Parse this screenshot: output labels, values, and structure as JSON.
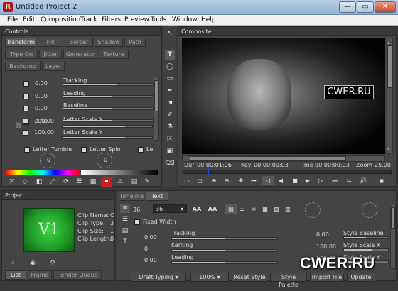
{
  "window": {
    "title": "Untitled Project 2",
    "app_icon_letter": "R",
    "minimize": "—",
    "maximize": "▭",
    "close": "✕"
  },
  "menu": [
    "File",
    "Edit",
    "Composition",
    "Track",
    "Filters",
    "Preview",
    "Tools",
    "Window",
    "Help"
  ],
  "controls": {
    "title": "Controls",
    "tabs_row1": [
      "Transform",
      "Fill",
      "Border",
      "Shadow",
      "Path"
    ],
    "tabs_row2": [
      "Type On",
      "Jitter",
      "Generator",
      "Texture"
    ],
    "tabs_row3": [
      "Backdrop",
      "Layer"
    ],
    "rows": [
      {
        "value": "0.00",
        "label": ""
      },
      {
        "value": "0.00",
        "label": "Tracking"
      },
      {
        "value": "0.00",
        "label": "Leading"
      },
      {
        "value": "0.00",
        "label": "Baseline"
      },
      {
        "value": "100.00",
        "label": "Letter Scale X"
      },
      {
        "value": "100.00",
        "label": "Letter Scale Y"
      }
    ],
    "checks": [
      "Letter Tumble",
      "Letter Spin",
      "Le"
    ],
    "knob_values": [
      "0",
      "0"
    ]
  },
  "composite": {
    "title": "Composite",
    "overlay_text": "CWER.RU",
    "dur_label": "Dur",
    "dur_value": "00:00:01:06",
    "key_label": "Key",
    "key_value": "00:00:00:03",
    "time_label": "Time",
    "time_value": "00:00:00:03",
    "zoom_label": "Zoom",
    "zoom_value": "25.00"
  },
  "project": {
    "title": "Project",
    "thumb_text": "V1",
    "fields": [
      {
        "label": "Clip Name:",
        "value": "C"
      },
      {
        "label": "Clip Type:",
        "value": "3"
      },
      {
        "label": "Clip Size:",
        "value": "1"
      },
      {
        "label": "Clip Length:",
        "value": "0"
      }
    ],
    "tabs": [
      "List",
      "Frame",
      "Render Queue"
    ]
  },
  "text_panel": {
    "tabs": [
      "Timeline",
      "Text"
    ],
    "size1": "36",
    "size2": "36",
    "fixed_width": "Fixed Width",
    "rows": [
      {
        "value": "0.00",
        "label": "Tracking",
        "right_value": "0.00",
        "right_label": "Style Baseline"
      },
      {
        "value": "0",
        "label": "Kerning",
        "right_value": "100.00",
        "right_label": "Style Scale X"
      },
      {
        "value": "0.00",
        "label": "Leading",
        "right_value": "100.00",
        "right_label": "Style Scale Y"
      }
    ]
  },
  "bottom_bar": {
    "draft": "Draft Typing",
    "zoom": "100%",
    "reset": "Reset Style",
    "palette": "Style Palette",
    "import": "Import File",
    "update": "Update"
  },
  "watermark": "CWER.RU",
  "colors": {
    "accent_blue": "#1a50d0",
    "thumb_green": "#1f9a28",
    "record_red": "#c82020"
  }
}
